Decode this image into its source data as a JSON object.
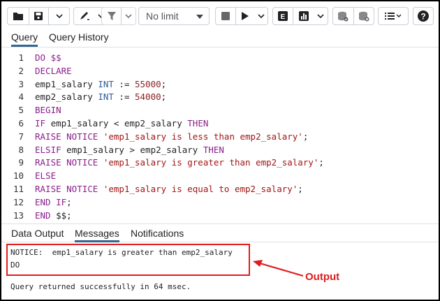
{
  "toolbar": {
    "limit_label": "No limit",
    "icons": [
      "folder-icon",
      "save-icon",
      "chevron-down-icon",
      "edit-pen-icon",
      "filter-icon",
      "stop-icon",
      "play-icon",
      "explain-icon",
      "analyze-chart-icon",
      "commit-icon",
      "rollback-icon",
      "macros-list-icon",
      "help-icon"
    ],
    "explain_glyph": "E",
    "help_glyph": "?"
  },
  "query_tabs": [
    {
      "label": "Query",
      "active": true
    },
    {
      "label": "Query History",
      "active": false
    }
  ],
  "editor": {
    "line_numbers": [
      "1",
      "2",
      "3",
      "4",
      "5",
      "6",
      "7",
      "8",
      "9",
      "10",
      "11",
      "12",
      "13"
    ],
    "lines": [
      [
        {
          "t": "DO $$",
          "c": "kw"
        }
      ],
      [
        {
          "t": "DECLARE",
          "c": "kw"
        }
      ],
      [
        {
          "t": "emp1_salary ",
          "c": ""
        },
        {
          "t": "INT",
          "c": "typ"
        },
        {
          "t": " := ",
          "c": ""
        },
        {
          "t": "55000",
          "c": "num"
        },
        {
          "t": ";",
          "c": ""
        }
      ],
      [
        {
          "t": "emp2_salary ",
          "c": ""
        },
        {
          "t": "INT",
          "c": "typ"
        },
        {
          "t": " := ",
          "c": ""
        },
        {
          "t": "54000",
          "c": "num"
        },
        {
          "t": ";",
          "c": ""
        }
      ],
      [
        {
          "t": "BEGIN",
          "c": "kw"
        }
      ],
      [
        {
          "t": "IF",
          "c": "kw"
        },
        {
          "t": " emp1_salary < emp2_salary ",
          "c": ""
        },
        {
          "t": "THEN",
          "c": "kw"
        }
      ],
      [
        {
          "t": "RAISE NOTICE",
          "c": "kw"
        },
        {
          "t": " ",
          "c": ""
        },
        {
          "t": "'emp1_salary is less than emp2_salary'",
          "c": "str"
        },
        {
          "t": ";",
          "c": ""
        }
      ],
      [
        {
          "t": "ELSIF",
          "c": "kw"
        },
        {
          "t": " emp1_salary > emp2_salary ",
          "c": ""
        },
        {
          "t": "THEN",
          "c": "kw"
        }
      ],
      [
        {
          "t": "RAISE NOTICE",
          "c": "kw"
        },
        {
          "t": " ",
          "c": ""
        },
        {
          "t": "'emp1_salary is greater than emp2_salary'",
          "c": "str"
        },
        {
          "t": ";",
          "c": ""
        }
      ],
      [
        {
          "t": "ELSE",
          "c": "kw"
        }
      ],
      [
        {
          "t": "RAISE NOTICE",
          "c": "kw"
        },
        {
          "t": " ",
          "c": ""
        },
        {
          "t": "'emp1_salary is equal to emp2_salary'",
          "c": "str"
        },
        {
          "t": ";",
          "c": ""
        }
      ],
      [
        {
          "t": "END IF",
          "c": "kw"
        },
        {
          "t": ";",
          "c": ""
        }
      ],
      [
        {
          "t": "END",
          "c": "kw"
        },
        {
          "t": " $$;",
          "c": ""
        }
      ]
    ]
  },
  "result_tabs": [
    {
      "label": "Data Output",
      "active": false
    },
    {
      "label": "Messages",
      "active": true
    },
    {
      "label": "Notifications",
      "active": false
    }
  ],
  "messages": {
    "notice": "NOTICE:  emp1_salary is greater than emp2_salary",
    "do": "DO",
    "status": "Query returned successfully in 64 msec."
  },
  "annotation": {
    "label": "Output",
    "color": "#e11b1b"
  },
  "colors": {
    "keyword": "#8b1e8b",
    "string": "#a31515",
    "number": "#8b1e1e",
    "type": "#2e5a9c",
    "accent": "#326690"
  }
}
